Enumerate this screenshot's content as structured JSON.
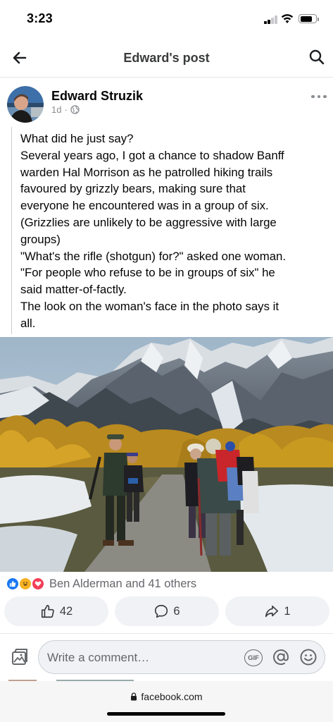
{
  "status_bar": {
    "time": "3:23"
  },
  "nav": {
    "title": "Edward's post",
    "back_icon": "arrow-left-icon",
    "search_icon": "search-icon"
  },
  "post": {
    "author": "Edward Struzik",
    "time_ago": "1d",
    "separator": "·",
    "audience_icon": "globe-icon",
    "lines": [
      "What did he just say?",
      "Several years ago, I got a chance to shadow Banff",
      "warden Hal Morrison as he patrolled hiking trails",
      "favoured by grizzly bears, making sure that",
      "everyone he encountered was in a group of six.",
      "(Grizzlies are unlikely to be aggressive with large",
      "groups)",
      "\"What's the rifle (shotgun) for?\" asked one woman.",
      "\"For people who refuse to be in groups of six\" he",
      "said matter-of-factly.",
      "The look on the woman's face in the photo says it",
      "all."
    ]
  },
  "reactions": {
    "summary": "Ben Alderman and 41 others",
    "types": [
      "like",
      "haha",
      "love"
    ]
  },
  "actions": {
    "likes": "42",
    "comments": "6",
    "shares": "1"
  },
  "comment": {
    "placeholder": "Write a comment…",
    "gif_label": "GIF"
  },
  "browser": {
    "url": "facebook.com"
  },
  "colors": {
    "accent": "#1877f2",
    "love": "#f33e58",
    "haha": "#f7b125",
    "secondary_text": "#65676b"
  }
}
